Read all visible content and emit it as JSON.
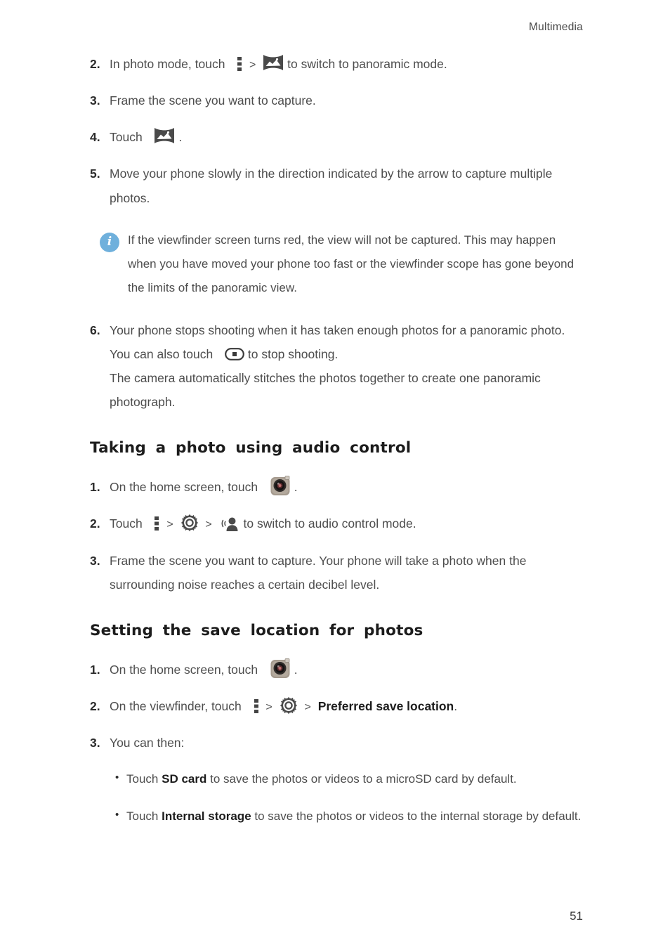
{
  "header": {
    "running_head": "Multimedia"
  },
  "page": {
    "number": "51"
  },
  "panorama_steps": [
    {
      "num": "2.",
      "text_before": "In photo mode, touch",
      "icon1": "overflow-menu-icon",
      "separator": ">",
      "icon2": "panorama-mode-icon",
      "text_after": "to switch to panoramic mode."
    },
    {
      "num": "3.",
      "text": "Frame the scene you want to capture."
    },
    {
      "num": "4.",
      "text_before": "Touch",
      "icon": "panorama-mode-icon",
      "text_after": "."
    },
    {
      "num": "5.",
      "text": "Move your phone slowly in the direction indicated by the arrow to capture multiple photos."
    }
  ],
  "note": {
    "icon": "info-icon",
    "icon_glyph": "i",
    "icon_color": "#6fb0dc",
    "text": "If the viewfinder screen turns red, the view will not be captured. This may happen when you have moved your phone too fast or the viewfinder scope has gone beyond the limits of the panoramic view."
  },
  "step6": {
    "num": "6.",
    "line1": "Your phone stops shooting when it has taken enough photos for a",
    "line2_before": "panoramic photo. You can also touch",
    "icon": "stop-shooting-icon",
    "line2_after": "to stop shooting.",
    "line3": "The camera automatically stitches the photos together to create one panoramic photograph."
  },
  "audio_section": {
    "heading": "Taking a photo using audio control",
    "steps": [
      {
        "num": "1.",
        "text_before": "On the home screen, touch",
        "icon": "camera-app-icon",
        "text_after": "."
      },
      {
        "num": "2.",
        "text_before": "Touch",
        "icon1": "overflow-menu-icon",
        "sep1": ">",
        "icon2": "settings-gear-icon",
        "sep2": ">",
        "icon3": "audio-control-icon",
        "text_after": "to switch to audio control mode."
      },
      {
        "num": "3.",
        "text": "Frame the scene you want to capture. Your phone will take a photo when the surrounding noise reaches a certain decibel level."
      }
    ]
  },
  "save_location_section": {
    "heading": "Setting the save location for photos",
    "steps": [
      {
        "num": "1.",
        "text_before": "On the home screen, touch",
        "icon": "camera-app-icon",
        "text_after": "."
      },
      {
        "num": "2.",
        "text_before": "On the viewfinder, touch",
        "icon1": "overflow-menu-icon",
        "sep1": ">",
        "icon2": "settings-gear-icon",
        "sep2": ">",
        "menu_item": "Preferred save location",
        "text_after": "."
      },
      {
        "num": "3.",
        "text": "You can then:"
      }
    ],
    "bullets": [
      {
        "marker": "•",
        "text_before": "Touch",
        "bold": "SD card",
        "text_after": "to save the photos or videos to a microSD card by default."
      },
      {
        "marker": "•",
        "text_before": "Touch",
        "bold": "Internal storage",
        "text_after": "to save the photos or videos to the internal storage by default."
      }
    ]
  }
}
